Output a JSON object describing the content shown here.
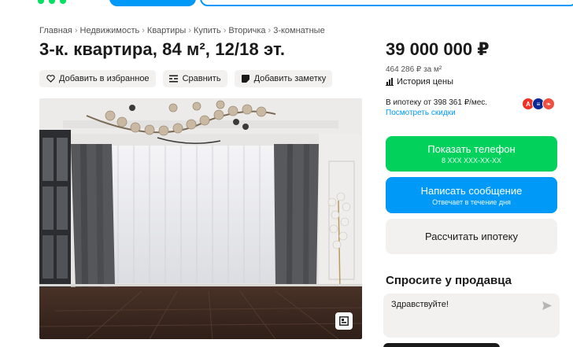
{
  "breadcrumb": [
    "Главная",
    "Недвижимость",
    "Квартиры",
    "Купить",
    "Вторичка",
    "3-комнатные"
  ],
  "title": "3-к. квартира, 84 м², 12/18 эт.",
  "actions": {
    "favorite": "Добавить в избранное",
    "compare": "Сравнить",
    "note": "Добавить заметку"
  },
  "price": {
    "value": "39 000 000 ₽",
    "per_meter": "464 286 ₽ за м²",
    "history": "История цены"
  },
  "mortgage": {
    "text": "В ипотеку от 398 361 ₽/мес.",
    "discounts": "Посмотреть скидки"
  },
  "buttons": {
    "phone": "Показать телефон",
    "phone_sub": "8 XXX XXX-XX-XX",
    "message": "Написать сообщение",
    "message_sub": "Отвечает в течение дня",
    "mortgage": "Рассчитать ипотеку"
  },
  "ask": {
    "title": "Спросите у продавца",
    "message": "Здравствуйте!"
  },
  "icons": {
    "favorite": "heart-icon",
    "compare": "compare-icon",
    "note": "note-icon",
    "history": "chart-icon",
    "send": "send-icon",
    "gallery": "gallery-icon"
  },
  "colors": {
    "green": "#02d15c",
    "blue": "#0099f7",
    "gray": "#f2f1f0",
    "alfa": "#ef3124",
    "vtb": "#0a2896",
    "bank3": "#f04e3e"
  }
}
